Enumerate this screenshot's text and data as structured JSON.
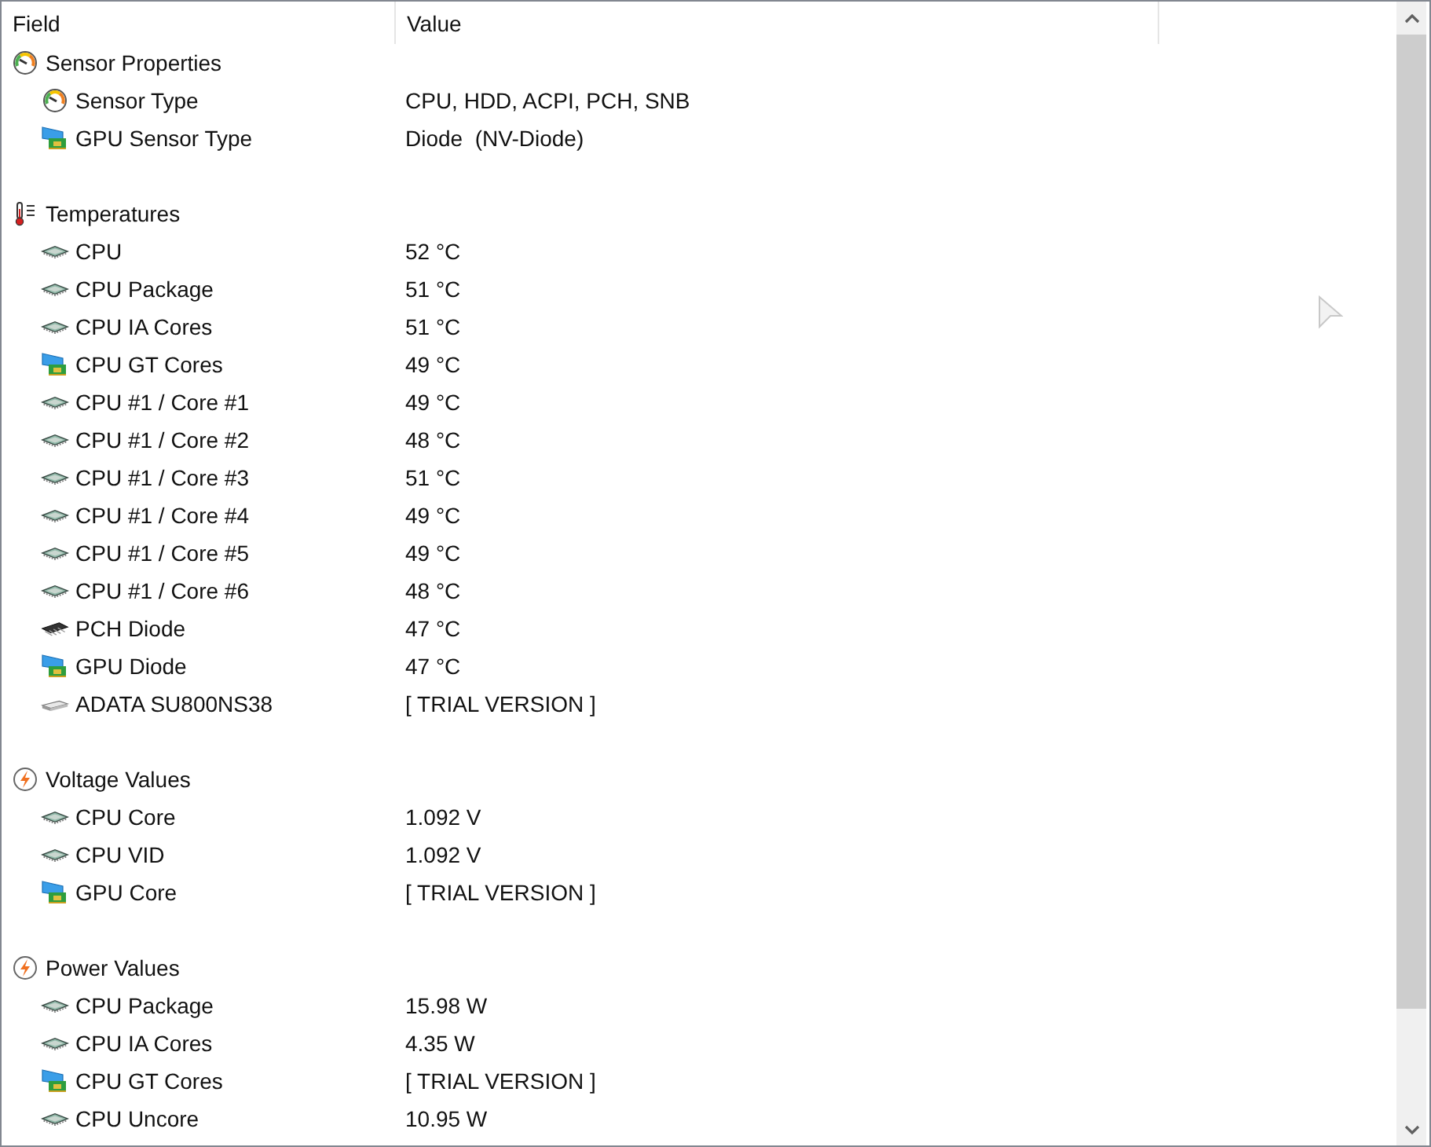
{
  "columns": [
    "Field",
    "Value"
  ],
  "groups": [
    {
      "label": "Sensor Properties",
      "kind": "gauge",
      "items": [
        {
          "field": "Sensor Type",
          "value": "CPU, HDD, ACPI, PCH, SNB",
          "kind": "gauge"
        },
        {
          "field": "GPU Sensor Type",
          "value": "Diode  (NV-Diode)",
          "kind": "gpu"
        }
      ]
    },
    {
      "label": "Temperatures",
      "kind": "thermometer",
      "items": [
        {
          "field": "CPU",
          "value": "52 °C",
          "kind": "chip"
        },
        {
          "field": "CPU Package",
          "value": "51 °C",
          "kind": "chip"
        },
        {
          "field": "CPU IA Cores",
          "value": "51 °C",
          "kind": "chip"
        },
        {
          "field": "CPU GT Cores",
          "value": "49 °C",
          "kind": "gpu"
        },
        {
          "field": "CPU #1 / Core #1",
          "value": "49 °C",
          "kind": "chip"
        },
        {
          "field": "CPU #1 / Core #2",
          "value": "48 °C",
          "kind": "chip"
        },
        {
          "field": "CPU #1 / Core #3",
          "value": "51 °C",
          "kind": "chip"
        },
        {
          "field": "CPU #1 / Core #4",
          "value": "49 °C",
          "kind": "chip"
        },
        {
          "field": "CPU #1 / Core #5",
          "value": "49 °C",
          "kind": "chip"
        },
        {
          "field": "CPU #1 / Core #6",
          "value": "48 °C",
          "kind": "chip"
        },
        {
          "field": "PCH Diode",
          "value": "47 °C",
          "kind": "pch"
        },
        {
          "field": "GPU Diode",
          "value": "47 °C",
          "kind": "gpu"
        },
        {
          "field": "ADATA SU800NS38",
          "value": "[ TRIAL VERSION ]",
          "kind": "drive"
        }
      ]
    },
    {
      "label": "Voltage Values",
      "kind": "bolt",
      "items": [
        {
          "field": "CPU Core",
          "value": "1.092 V",
          "kind": "chip"
        },
        {
          "field": "CPU VID",
          "value": "1.092 V",
          "kind": "chip"
        },
        {
          "field": "GPU Core",
          "value": "[ TRIAL VERSION ]",
          "kind": "gpu"
        }
      ]
    },
    {
      "label": "Power Values",
      "kind": "bolt",
      "items": [
        {
          "field": "CPU Package",
          "value": "15.98 W",
          "kind": "chip"
        },
        {
          "field": "CPU IA Cores",
          "value": "4.35 W",
          "kind": "chip"
        },
        {
          "field": "CPU GT Cores",
          "value": "[ TRIAL VERSION ]",
          "kind": "gpu"
        },
        {
          "field": "CPU Uncore",
          "value": "10.95 W",
          "kind": "chip"
        }
      ]
    }
  ]
}
